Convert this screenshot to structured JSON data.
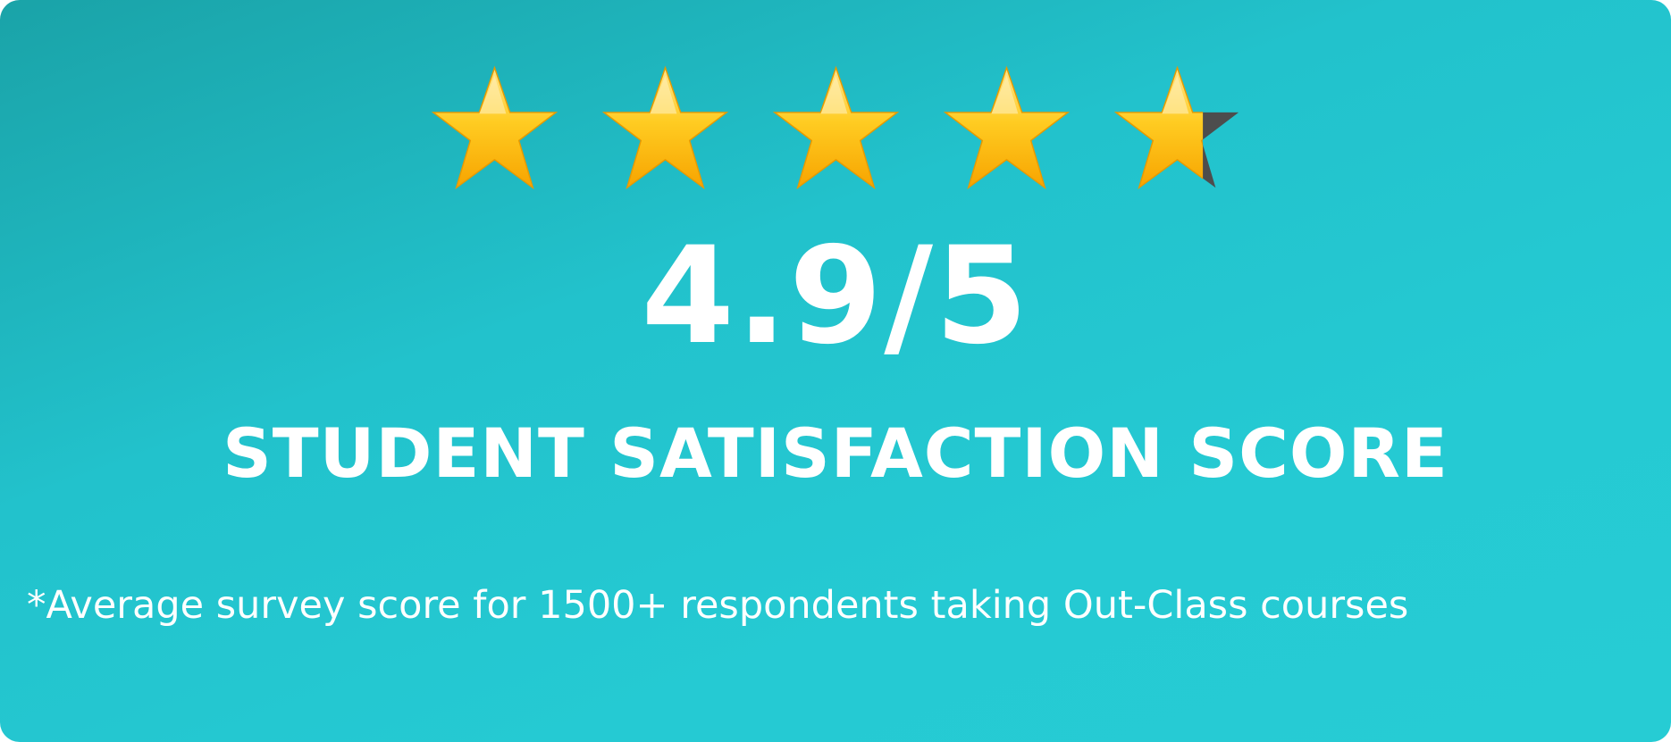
{
  "rating": {
    "value": 4.9,
    "max": 5,
    "score_text": "4.9/5",
    "star_color": "#ffc107",
    "empty_star_color": "#4d4d4d",
    "stars": [
      {
        "icon": "star-icon",
        "fill": 1.0
      },
      {
        "icon": "star-icon",
        "fill": 1.0
      },
      {
        "icon": "star-icon",
        "fill": 1.0
      },
      {
        "icon": "star-icon",
        "fill": 1.0
      },
      {
        "icon": "star-icon",
        "fill": 0.7
      }
    ]
  },
  "heading": "STUDENT SATISFACTION SCORE",
  "footnote": "*Average survey score for 1500+ respondents taking Out-Class courses",
  "colors": {
    "background_start": "#1aa3a8",
    "background_end": "#26ccd4",
    "text": "#ffffff"
  }
}
